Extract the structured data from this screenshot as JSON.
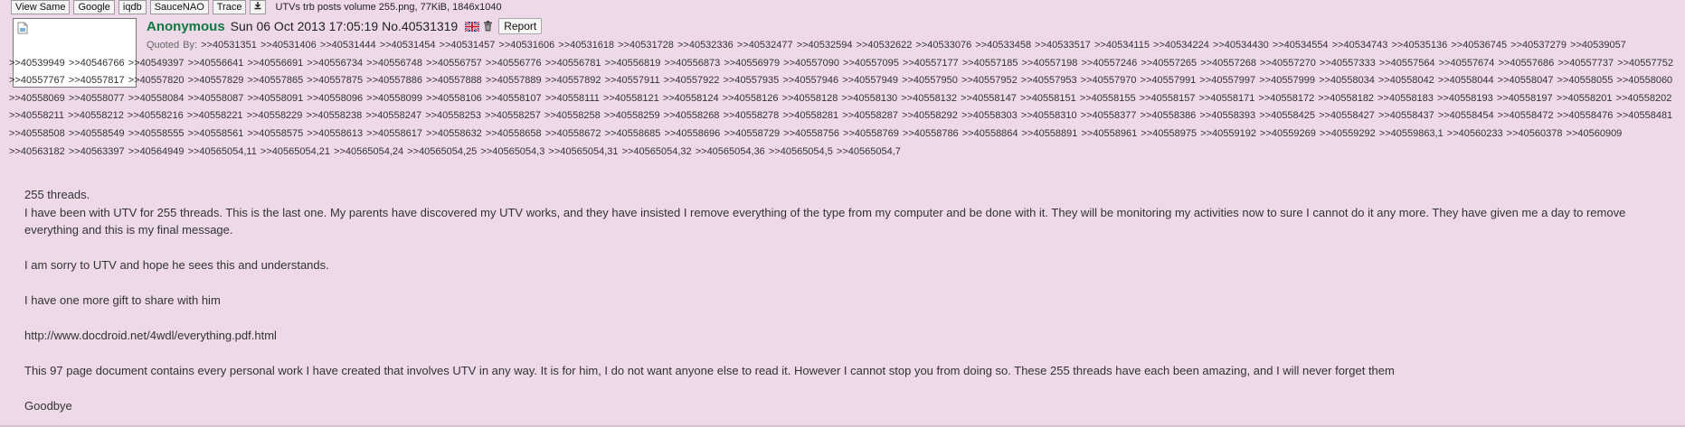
{
  "toolbar": {
    "buttons": [
      "View Same",
      "Google",
      "iqdb",
      "SauceNAO",
      "Trace"
    ],
    "download_icon": "download-icon",
    "file_info": "UTVs trb posts volume 255.png, 77KiB, 1846x1040"
  },
  "post": {
    "name": "Anonymous",
    "datetime": "Sun 06 Oct 2013 17:05:19",
    "number": "No.40531319",
    "flag_icon": "uk-flag-icon",
    "trash_icon": "trash-icon",
    "report_label": "Report",
    "thumbnail_icon": "broken-image-icon"
  },
  "quoted_by": {
    "label": "Quoted By:",
    "links": [
      ">>40531351",
      ">>40531406",
      ">>40531444",
      ">>40531454",
      ">>40531457",
      ">>40531606",
      ">>40531618",
      ">>40531728",
      ">>40532336",
      ">>40532477",
      ">>40532594",
      ">>40532622",
      ">>40533076",
      ">>40533458",
      ">>40533517",
      ">>40534115",
      ">>40534224",
      ">>40534430",
      ">>40534554",
      ">>40534743",
      ">>40535136",
      ">>40536745",
      ">>40537279",
      ">>40539057",
      ">>40539949",
      ">>40546766",
      ">>40549397",
      ">>40556641",
      ">>40556691",
      ">>40556734",
      ">>40556748",
      ">>40556757",
      ">>40556776",
      ">>40556781",
      ">>40556819",
      ">>40556873",
      ">>40556979",
      ">>40557090",
      ">>40557095",
      ">>40557177",
      ">>40557185",
      ">>40557198",
      ">>40557246",
      ">>40557265",
      ">>40557268",
      ">>40557270",
      ">>40557333",
      ">>40557564",
      ">>40557674",
      ">>40557686",
      ">>40557737",
      ">>40557752",
      ">>40557767",
      ">>40557817",
      ">>40557820",
      ">>40557829",
      ">>40557865",
      ">>40557875",
      ">>40557886",
      ">>40557888",
      ">>40557889",
      ">>40557892",
      ">>40557911",
      ">>40557922",
      ">>40557935",
      ">>40557946",
      ">>40557949",
      ">>40557950",
      ">>40557952",
      ">>40557953",
      ">>40557970",
      ">>40557991",
      ">>40557997",
      ">>40557999",
      ">>40558034",
      ">>40558042",
      ">>40558044",
      ">>40558047",
      ">>40558055",
      ">>40558060",
      ">>40558069",
      ">>40558077",
      ">>40558084",
      ">>40558087",
      ">>40558091",
      ">>40558096",
      ">>40558099",
      ">>40558106",
      ">>40558107",
      ">>40558111",
      ">>40558121",
      ">>40558124",
      ">>40558126",
      ">>40558128",
      ">>40558130",
      ">>40558132",
      ">>40558147",
      ">>40558151",
      ">>40558155",
      ">>40558157",
      ">>40558171",
      ">>40558172",
      ">>40558182",
      ">>40558183",
      ">>40558193",
      ">>40558197",
      ">>40558201",
      ">>40558202",
      ">>40558211",
      ">>40558212",
      ">>40558216",
      ">>40558221",
      ">>40558229",
      ">>40558238",
      ">>40558247",
      ">>40558253",
      ">>40558257",
      ">>40558258",
      ">>40558259",
      ">>40558268",
      ">>40558278",
      ">>40558281",
      ">>40558287",
      ">>40558292",
      ">>40558303",
      ">>40558310",
      ">>40558377",
      ">>40558386",
      ">>40558393",
      ">>40558425",
      ">>40558427",
      ">>40558437",
      ">>40558454",
      ">>40558472",
      ">>40558476",
      ">>40558481",
      ">>40558508",
      ">>40558549",
      ">>40558555",
      ">>40558561",
      ">>40558575",
      ">>40558613",
      ">>40558617",
      ">>40558632",
      ">>40558658",
      ">>40558672",
      ">>40558685",
      ">>40558696",
      ">>40558729",
      ">>40558756",
      ">>40558769",
      ">>40558786",
      ">>40558864",
      ">>40558891",
      ">>40558961",
      ">>40558975",
      ">>40559192",
      ">>40559269",
      ">>40559292",
      ">>40559863,1",
      ">>40560233",
      ">>40560378",
      ">>40560909",
      ">>40563182",
      ">>40563397",
      ">>40564949",
      ">>40565054,11",
      ">>40565054,21",
      ">>40565054,24",
      ">>40565054,25",
      ">>40565054,3",
      ">>40565054,31",
      ">>40565054,32",
      ">>40565054,36",
      ">>40565054,5",
      ">>40565054,7"
    ]
  },
  "message": {
    "paragraphs": [
      "255 threads.",
      "I have been with UTV for 255 threads. This is the last one. My parents have discovered my UTV works, and they have insisted I remove everything of the type from my computer and be done with it. They will be monitoring my activities now to sure I cannot do it any more. They have given me a day to remove everything and this is my final message.",
      "",
      "I am sorry to UTV and hope he sees this and understands.",
      "",
      "I have one more gift to share with him",
      "",
      "http://www.docdroid.net/4wdl/everything.pdf.html",
      "",
      "This 97 page document contains every personal work I have created that involves UTV in any way. It is for him, I do not want anyone else to read it. However I cannot stop you from doing so. These 255 threads have each been amazing, and I will never forget them",
      "",
      "Goodbye"
    ]
  },
  "colors": {
    "background": "#eed9e9",
    "name": "#117743",
    "text": "#333333"
  }
}
